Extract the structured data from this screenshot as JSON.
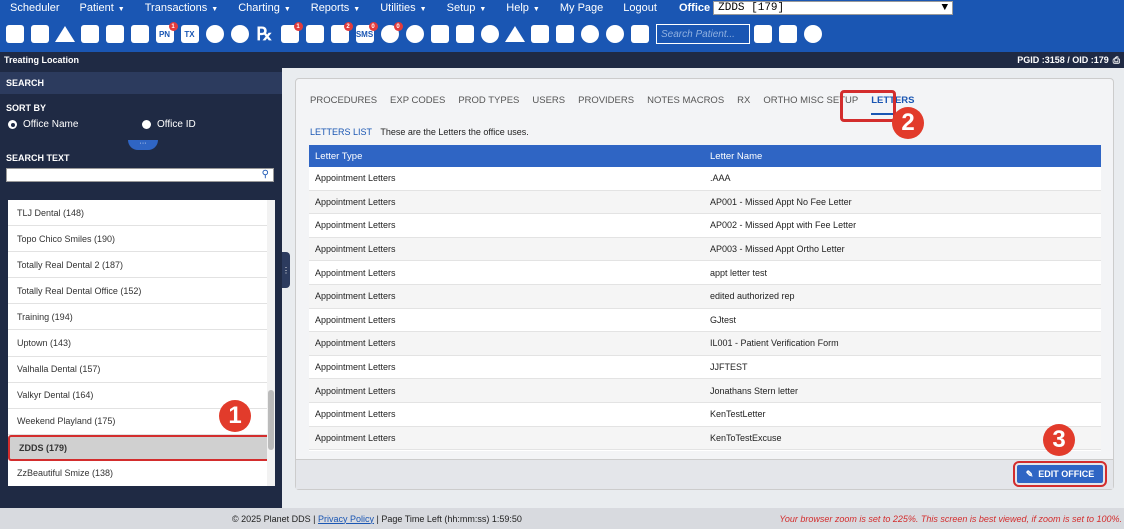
{
  "menu": {
    "items": [
      {
        "label": "Scheduler",
        "caret": false
      },
      {
        "label": "Patient",
        "caret": true
      },
      {
        "label": "Transactions",
        "caret": true
      },
      {
        "label": "Charting",
        "caret": true
      },
      {
        "label": "Reports",
        "caret": true
      },
      {
        "label": "Utilities",
        "caret": true
      },
      {
        "label": "Setup",
        "caret": true
      },
      {
        "label": "Help",
        "caret": true
      },
      {
        "label": "My Page",
        "caret": false
      },
      {
        "label": "Logout",
        "caret": false
      }
    ],
    "office_label": "Office",
    "office_value": "ZDDS [179]"
  },
  "toolbar": {
    "search_placeholder": "Search Patient...",
    "badges": {
      "icon7": "1",
      "icon12": "1",
      "icon14": "2",
      "icon15": "0",
      "icon16": "0"
    }
  },
  "treating": {
    "title": "Treating Location",
    "ids": "PGID :3158  /  OID :179"
  },
  "sidebar": {
    "search_title": "SEARCH",
    "sort_title": "SORT BY",
    "sort_options": [
      "Office Name",
      "Office ID"
    ],
    "search_text_title": "SEARCH TEXT",
    "offices": [
      "TLJ Dental (148)",
      "Topo Chico Smiles (190)",
      "Totally Real Dental 2 (187)",
      "Totally Real Dental Office (152)",
      "Training (194)",
      "Uptown (143)",
      "Valhalla Dental (157)",
      "Valkyr Dental (164)",
      "Weekend Playland (175)",
      "ZDDS (179)",
      "ZzBeautiful Smize (138)"
    ],
    "selected_index": 9
  },
  "main": {
    "tabs": [
      "PROCEDURES",
      "EXP CODES",
      "PROD TYPES",
      "USERS",
      "PROVIDERS",
      "NOTES MACROS",
      "RX",
      "ORTHO MISC SETUP",
      "LETTERS"
    ],
    "active_tab": 8,
    "list_label": "LETTERS LIST",
    "list_desc": "These are the Letters the office uses.",
    "columns": [
      "Letter Type",
      "Letter Name"
    ],
    "rows": [
      [
        "Appointment Letters",
        ".AAA"
      ],
      [
        "Appointment Letters",
        "AP001 - Missed Appt No Fee Letter"
      ],
      [
        "Appointment Letters",
        "AP002 - Missed Appt with Fee Letter"
      ],
      [
        "Appointment Letters",
        "AP003 - Missed Appt Ortho Letter"
      ],
      [
        "Appointment Letters",
        "appt letter test"
      ],
      [
        "Appointment Letters",
        "edited authorized rep"
      ],
      [
        "Appointment Letters",
        "GJtest"
      ],
      [
        "Appointment Letters",
        "IL001 - Patient Verification Form"
      ],
      [
        "Appointment Letters",
        "JJFTEST"
      ],
      [
        "Appointment Letters",
        "Jonathans Stern letter"
      ],
      [
        "Appointment Letters",
        "KenTestLetter"
      ],
      [
        "Appointment Letters",
        "KenToTestExcuse"
      ]
    ],
    "edit_button": "EDIT OFFICE"
  },
  "markers": [
    "1",
    "2",
    "3"
  ],
  "status": {
    "copyright": "© 2025 Planet DDS | ",
    "privacy": "Privacy Policy",
    "time_left": " | Page Time Left (hh:mm:ss) 1:59:50",
    "zoom_warning": "Your browser zoom is set to 225%. This screen is best viewed, if zoom is set to 100%."
  },
  "colors": {
    "brand": "#1a56b3",
    "sidebar": "#1f2a44",
    "marker": "#e23b2b"
  }
}
